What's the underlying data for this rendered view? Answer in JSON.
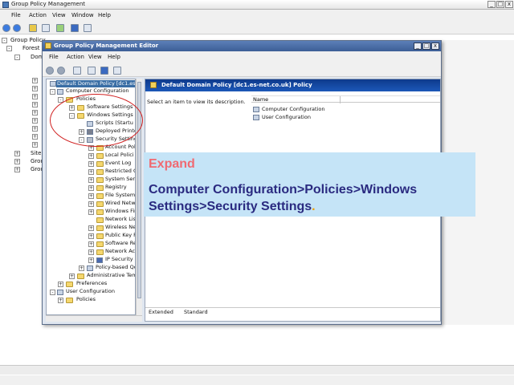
{
  "outer": {
    "title": "Group Policy Management",
    "menu": [
      "File",
      "Action",
      "View",
      "Window",
      "Help"
    ],
    "tree": [
      "Group Policy",
      "Forest",
      "Dom",
      "Site",
      "Grou",
      "Grou"
    ],
    "icons": {
      "back": "back-arrow-icon",
      "forward": "forward-arrow-icon"
    }
  },
  "editor": {
    "title": "Group Policy Management Editor",
    "menu": [
      "File",
      "Action",
      "View",
      "Help"
    ],
    "tree": {
      "root": "Default Domain Policy [dc1.es-n",
      "computer_config": "Computer Configuration",
      "policies": "Policies",
      "software_settings": "Software Settings",
      "windows_settings": "Windows Settings",
      "scripts": "Scripts (Startu",
      "deployed_printers": "Deployed Printe",
      "security_settings": "Security Setting",
      "security_children": [
        "Account Pol",
        "Local Polici",
        "Event Log",
        "Restricted C",
        "System Serv",
        "Registry",
        "File System",
        "Wired Netw",
        "Windows Fir",
        "Network Lis",
        "Wireless Ne",
        "Public Key P",
        "Software Re",
        "Network Acc",
        "IP Security"
      ],
      "policy_based_qos": "Policy-based Qo",
      "admin_templates": "Administrative Temp",
      "preferences": "Preferences",
      "user_config": "User Configuration",
      "user_policies": "Policies"
    },
    "right": {
      "header": "Default Domain Policy [dc1.es-net.co.uk] Policy",
      "description": "Select an item to view its description.",
      "column_name": "Name",
      "items": [
        "Computer Configuration",
        "User Configuration"
      ],
      "tabs": [
        "Extended",
        "Standard"
      ]
    }
  },
  "instruction": {
    "heading": "Expand",
    "body": "Computer Configuration>Policies>Windows Settings>Security Settings",
    "terminal": ".",
    "heading_color": "#f06a72",
    "body_color": "#2a2a80",
    "background": "#c5e4f7"
  }
}
